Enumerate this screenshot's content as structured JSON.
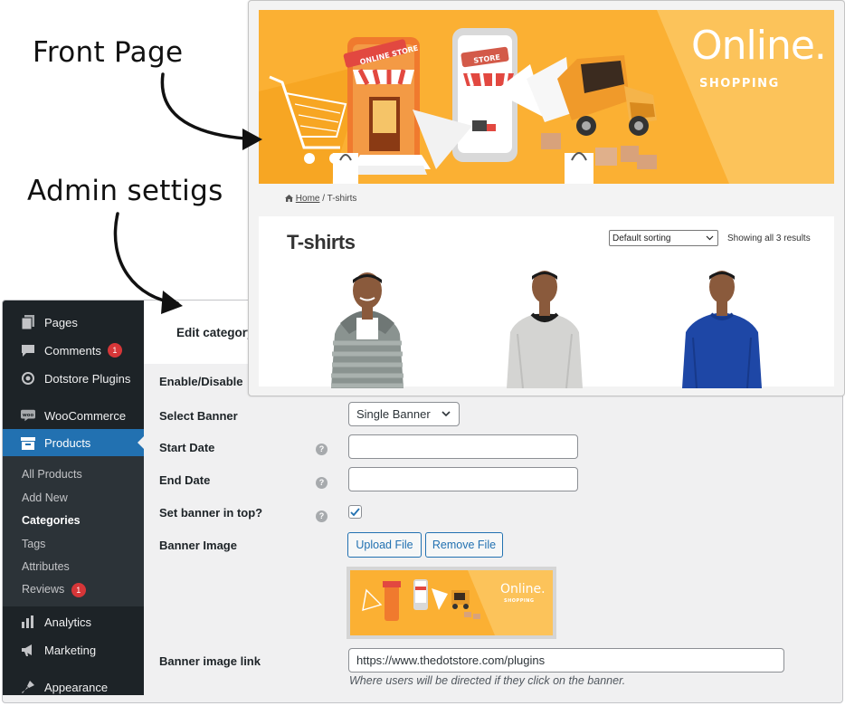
{
  "annotations": {
    "front_page": "Front Page",
    "admin_settings": "Admin settigs"
  },
  "storefront": {
    "banner": {
      "headline": "Online.",
      "tagline": "SHOPPING",
      "store_sign_1": "ONLINE STORE",
      "store_sign_2": "STORE"
    },
    "breadcrumb": {
      "home": "Home",
      "separator": "/",
      "current": "T-shirts"
    },
    "page_title": "T-shirts",
    "sorting": {
      "selected": "Default sorting"
    },
    "result_count": "Showing all 3 results",
    "products": [
      {
        "style": "striped-hoodie",
        "color": "#8a9390"
      },
      {
        "style": "grey-sweatshirt",
        "color": "#d4d4d2"
      },
      {
        "style": "blue-long-sleeve",
        "color": "#1e47a6"
      }
    ]
  },
  "admin": {
    "sidebar": {
      "items": [
        {
          "label": "Pages",
          "icon": "pages-icon"
        },
        {
          "label": "Comments",
          "icon": "comments-icon",
          "badge": "1"
        },
        {
          "label": "Dotstore Plugins",
          "icon": "dotstore-icon"
        },
        {
          "label": "WooCommerce",
          "icon": "woocommerce-icon"
        },
        {
          "label": "Products",
          "icon": "products-icon",
          "active": true
        },
        {
          "label": "Analytics",
          "icon": "analytics-icon"
        },
        {
          "label": "Marketing",
          "icon": "marketing-icon"
        },
        {
          "label": "Appearance",
          "icon": "appearance-icon"
        }
      ],
      "submenu": [
        {
          "label": "All Products"
        },
        {
          "label": "Add New"
        },
        {
          "label": "Categories",
          "current": true
        },
        {
          "label": "Tags"
        },
        {
          "label": "Attributes"
        },
        {
          "label": "Reviews",
          "badge": "1"
        }
      ]
    },
    "header": {
      "title": "Edit category"
    },
    "form": {
      "enable_disable_label": "Enable/Disable",
      "select_banner_label": "Select Banner",
      "select_banner_value": "Single Banner",
      "start_date_label": "Start Date",
      "start_date_value": "",
      "end_date_label": "End Date",
      "end_date_value": "",
      "set_top_label": "Set banner in top?",
      "set_top_checked": true,
      "banner_image_label": "Banner Image",
      "upload_button": "Upload File",
      "remove_button": "Remove File",
      "preview_headline": "Online.",
      "preview_tagline": "SHOPPING",
      "banner_link_label": "Banner image link",
      "banner_link_value": "https://www.thedotstore.com/plugins",
      "banner_link_hint": "Where users will be directed if they click on the banner."
    },
    "colors": {
      "sidebar_bg": "#1d2327",
      "active_menu": "#2271b1",
      "badge": "#d63638",
      "banner_orange": "#fbb033"
    }
  }
}
